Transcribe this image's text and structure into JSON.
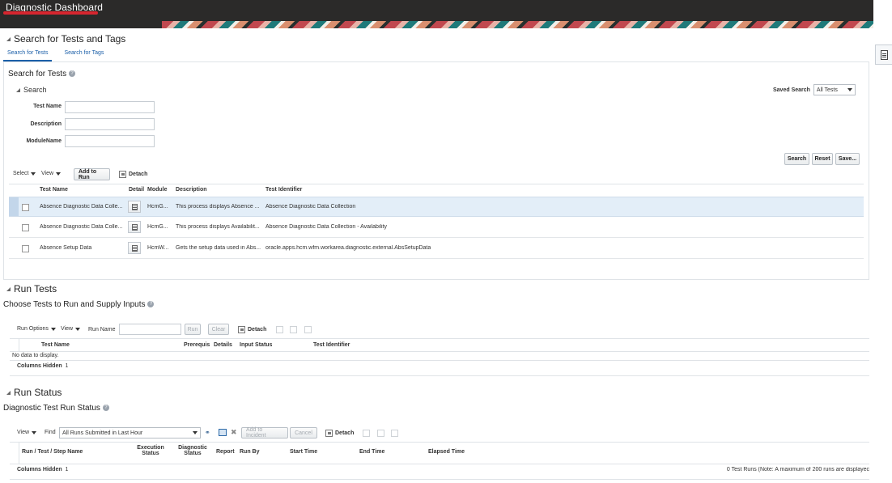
{
  "app": {
    "title": "Diagnostic Dashboard"
  },
  "search_section": {
    "header": "Search for Tests and Tags",
    "tabs": [
      "Search for Tests",
      "Search for Tags"
    ],
    "panel_title": "Search for Tests",
    "search_label": "Search",
    "saved_search_label": "Saved Search",
    "saved_search_value": "All Tests",
    "fields": [
      {
        "label": "Test Name",
        "value": ""
      },
      {
        "label": "Description",
        "value": ""
      },
      {
        "label": "ModuleName",
        "value": ""
      }
    ],
    "buttons": {
      "search": "Search",
      "reset": "Reset",
      "save": "Save..."
    },
    "toolbar": {
      "select": "Select",
      "view": "View",
      "add_to_run": "Add to Run",
      "detach": "Detach"
    },
    "columns": [
      "Test Name",
      "Detail",
      "Module",
      "Description",
      "Test Identifier"
    ],
    "rows": [
      {
        "name": "Absence Diagnostic Data Colle...",
        "module": "HcmG...",
        "description": "This process displays Absence ...",
        "identifier": "Absence Diagnostic Data Collection"
      },
      {
        "name": "Absence Diagnostic Data Colle...",
        "module": "HcmG...",
        "description": "This process displays Availabilit...",
        "identifier": "Absence Diagnostic Data Collection - Availability"
      },
      {
        "name": "Absence Setup Data",
        "module": "HcmW...",
        "description": "Gets the setup data used in Abs...",
        "identifier": "oracle.apps.hcm.wfm.workarea.diagnostic.external.AbsSetupData"
      }
    ]
  },
  "run_section": {
    "header": "Run Tests",
    "title": "Choose Tests to Run and Supply Inputs",
    "toolbar": {
      "run_options": "Run Options",
      "view": "View",
      "run_name_label": "Run Name",
      "run": "Run",
      "clear": "Clear",
      "detach": "Detach"
    },
    "columns": [
      "Test Name",
      "Prerequis",
      "Details",
      "Input Status",
      "Test Identifier"
    ],
    "empty": "No data to display.",
    "columns_hidden_label": "Columns Hidden",
    "columns_hidden_count": "1"
  },
  "status_section": {
    "header": "Run Status",
    "title": "Diagnostic Test Run Status",
    "toolbar": {
      "view": "View",
      "find": "Find",
      "find_value": "All Runs Submitted in Last Hour",
      "add_to_incident": "Add to Incident",
      "cancel": "Cancel",
      "detach": "Detach"
    },
    "columns": [
      "Run / Test / Step Name",
      "Execution Status",
      "Diagnostic Status",
      "Report",
      "Run By",
      "Start Time",
      "End Time",
      "Elapsed Time"
    ],
    "columns_hidden_label": "Columns Hidden",
    "columns_hidden_count": "1",
    "footer_note": "0 Test Runs (Note: A maximum of 200 runs are displayec"
  },
  "colors": {
    "banner": "#2b2a29",
    "accent_red": "#d7262f",
    "link_blue": "#1b5fa8",
    "selected_row": "#e3eef8"
  }
}
